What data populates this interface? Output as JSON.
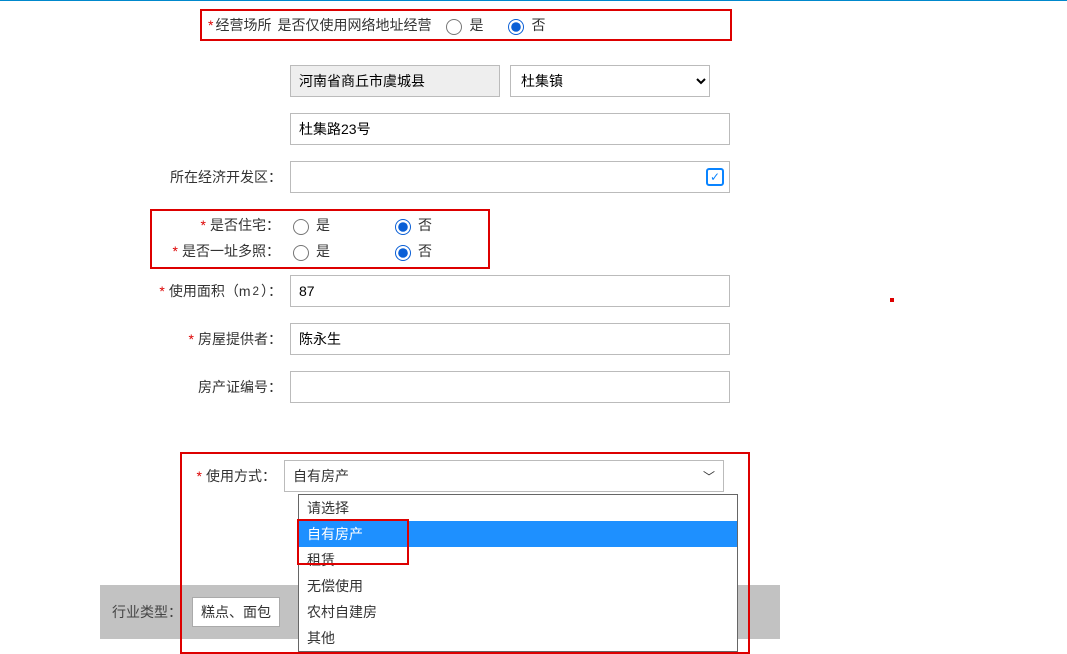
{
  "row1": {
    "label": "经营场所",
    "inline_text": "是否仅使用网络地址经营",
    "yes": "是",
    "no": "否",
    "selected": "否"
  },
  "region": {
    "disabled_value": "河南省商丘市虞城县",
    "town_selected": "杜集镇",
    "town_options": [
      "杜集镇"
    ]
  },
  "address": {
    "value": "杜集路23号"
  },
  "zone": {
    "label": "所在经济开发区：",
    "value": ""
  },
  "is_residential": {
    "label": "*是否住宅：",
    "yes": "是",
    "no": "否",
    "selected": "否"
  },
  "multi_license": {
    "label": "*是否一址多照：",
    "yes": "是",
    "no": "否",
    "selected": "否"
  },
  "area": {
    "label_prefix": "使用面积（m",
    "label_suffix": "）：",
    "value": "87"
  },
  "provider": {
    "label": "房屋提供者：",
    "value": "陈永生"
  },
  "cert_no": {
    "label": "房产证编号：",
    "value": ""
  },
  "use_mode": {
    "label": "使用方式：",
    "selected": "自有房产",
    "options": [
      "请选择",
      "自有房产",
      "租赁",
      "无偿使用",
      "农村自建房",
      "其他"
    ]
  },
  "bottom": {
    "label": "行业类型：",
    "value": "糕点、面包"
  }
}
